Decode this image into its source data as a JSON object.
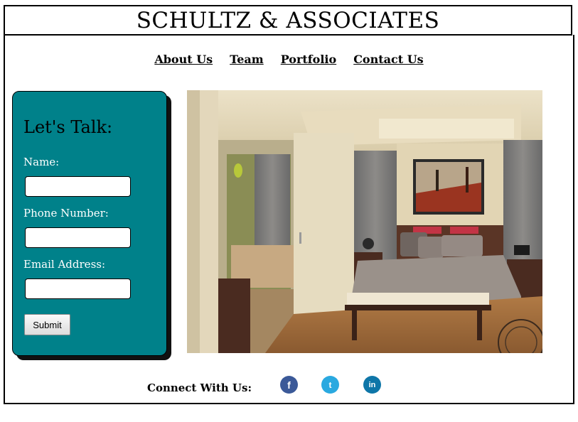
{
  "header": {
    "title": "SCHULTZ & ASSOCIATES"
  },
  "nav": {
    "items": [
      "About Us",
      "Team",
      "Portfolio",
      "Contact Us"
    ]
  },
  "contact_form": {
    "heading": "Let's Talk:",
    "name_label": "Name:",
    "phone_label": "Phone Number:",
    "email_label": "Email Address:",
    "name_value": "",
    "phone_value": "",
    "email_value": "",
    "submit_label": "Submit",
    "panel_color": "#00818a"
  },
  "hero": {
    "description_icon": "bedroom-photo"
  },
  "footer": {
    "connect_label": "Connect With Us:",
    "social": [
      {
        "name": "facebook-icon",
        "glyph": "f",
        "color": "#3b5998"
      },
      {
        "name": "twitter-icon",
        "glyph": "t",
        "color": "#2aa9e0"
      },
      {
        "name": "linkedin-icon",
        "glyph": "in",
        "color": "#0e76a8"
      }
    ]
  }
}
